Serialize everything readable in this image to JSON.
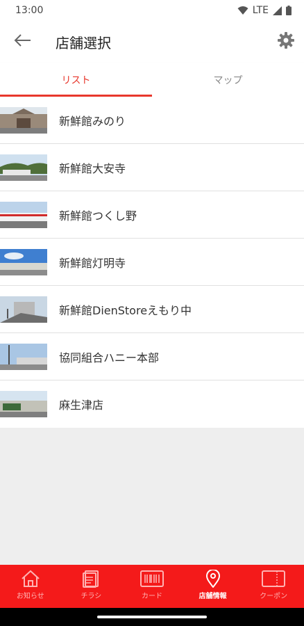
{
  "status_bar": {
    "time": "13:00",
    "network": "LTE"
  },
  "app_bar": {
    "title": "店舗選択"
  },
  "tabs": [
    {
      "label": "リスト",
      "active": true
    },
    {
      "label": "マップ",
      "active": false
    }
  ],
  "stores": [
    {
      "name": "新鮮館みのり"
    },
    {
      "name": "新鮮館大安寺"
    },
    {
      "name": "新鮮館つくし野"
    },
    {
      "name": "新鮮館灯明寺"
    },
    {
      "name": "新鮮館DienStoreえもり中"
    },
    {
      "name": "協同組合ハニー本部"
    },
    {
      "name": "麻生津店"
    }
  ],
  "bottom_nav": [
    {
      "label": "お知らせ",
      "icon": "home-icon",
      "active": false
    },
    {
      "label": "チラシ",
      "icon": "flyer-icon",
      "active": false
    },
    {
      "label": "カード",
      "icon": "barcode-card-icon",
      "active": false
    },
    {
      "label": "店舗情報",
      "icon": "location-pin-icon",
      "active": true
    },
    {
      "label": "クーポン",
      "icon": "coupon-icon",
      "active": false
    }
  ],
  "colors": {
    "accent": "#e8372c",
    "nav_background": "#f41a1a"
  }
}
